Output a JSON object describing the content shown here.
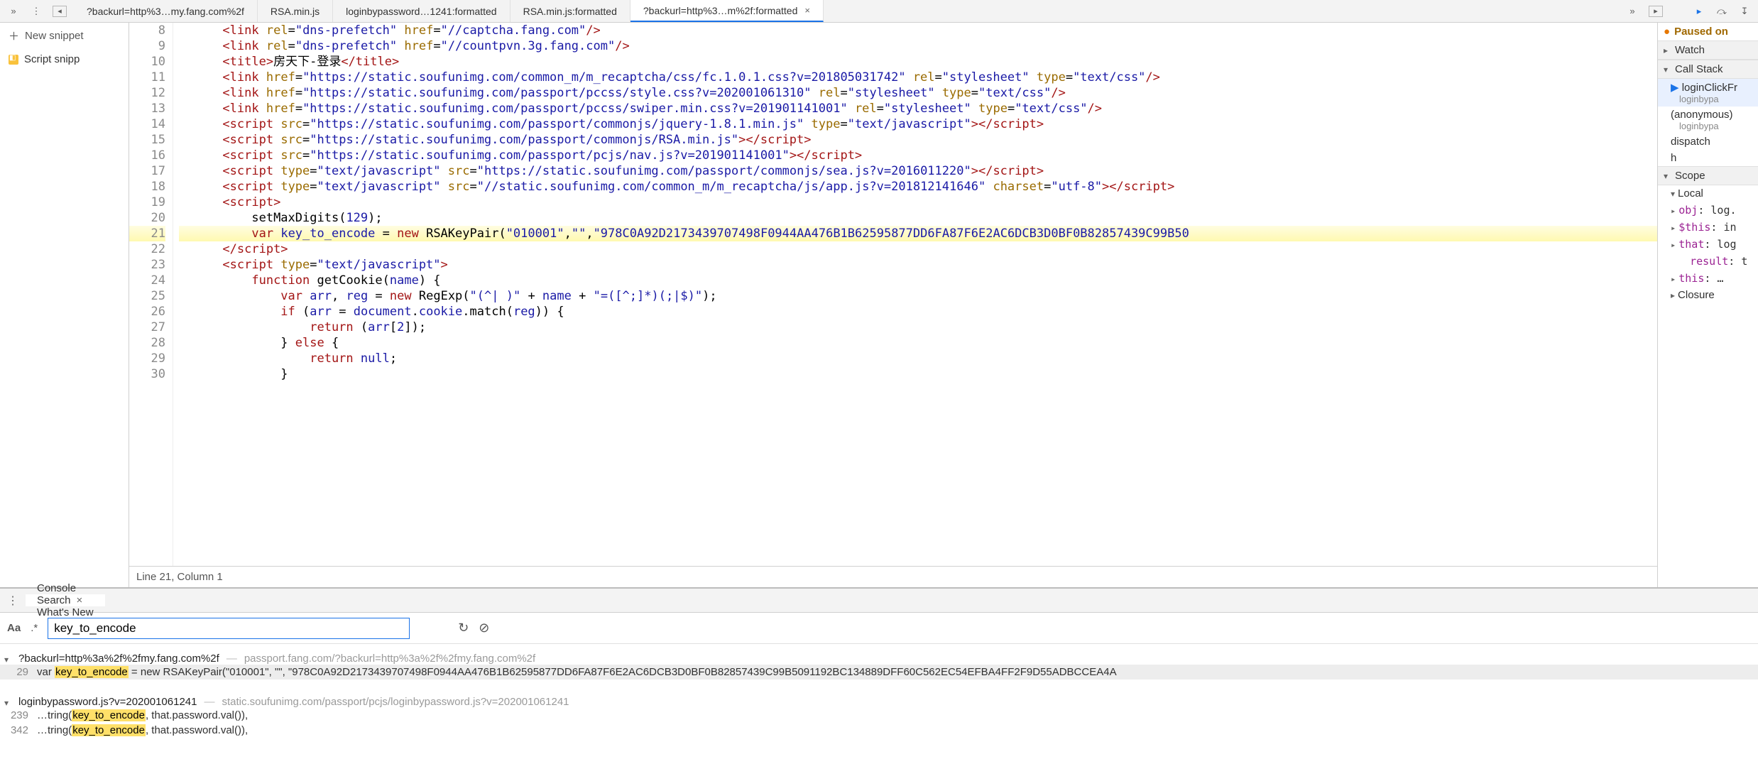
{
  "toolbar": {
    "tabs": [
      "?backurl=http%3…my.fang.com%2f",
      "RSA.min.js",
      "loginbypassword…1241:formatted",
      "RSA.min.js:formatted",
      "?backurl=http%3…m%2f:formatted"
    ],
    "active_tab_index": 4
  },
  "sidebar": {
    "add_label": "New snippet",
    "item_label": "Script snipp"
  },
  "code": {
    "first_line_no": 8,
    "status": "Line 21, Column 1",
    "lines_tokens": [
      [
        [
          "t-tag",
          "<link"
        ],
        [
          "t-js",
          " "
        ],
        [
          "t-attr",
          "rel"
        ],
        [
          "t-js",
          "="
        ],
        [
          "t-str",
          "\"dns-prefetch\""
        ],
        [
          "t-js",
          " "
        ],
        [
          "t-attr",
          "href"
        ],
        [
          "t-js",
          "="
        ],
        [
          "t-str",
          "\"//captcha.fang.com\""
        ],
        [
          "t-tag",
          "/>"
        ]
      ],
      [
        [
          "t-tag",
          "<link"
        ],
        [
          "t-js",
          " "
        ],
        [
          "t-attr",
          "rel"
        ],
        [
          "t-js",
          "="
        ],
        [
          "t-str",
          "\"dns-prefetch\""
        ],
        [
          "t-js",
          " "
        ],
        [
          "t-attr",
          "href"
        ],
        [
          "t-js",
          "="
        ],
        [
          "t-str",
          "\"//countpvn.3g.fang.com\""
        ],
        [
          "t-tag",
          "/>"
        ]
      ],
      [
        [
          "t-tag",
          "<title>"
        ],
        [
          "t-text",
          "房天下-登录"
        ],
        [
          "t-tag",
          "</title>"
        ]
      ],
      [
        [
          "t-tag",
          "<link"
        ],
        [
          "t-js",
          " "
        ],
        [
          "t-attr",
          "href"
        ],
        [
          "t-js",
          "="
        ],
        [
          "t-str",
          "\"https://static.soufunimg.com/common_m/m_recaptcha/css/fc.1.0.1.css?v=201805031742\""
        ],
        [
          "t-js",
          " "
        ],
        [
          "t-attr",
          "rel"
        ],
        [
          "t-js",
          "="
        ],
        [
          "t-str",
          "\"stylesheet\""
        ],
        [
          "t-js",
          " "
        ],
        [
          "t-attr",
          "type"
        ],
        [
          "t-js",
          "="
        ],
        [
          "t-str",
          "\"text/css\""
        ],
        [
          "t-tag",
          "/>"
        ]
      ],
      [
        [
          "t-tag",
          "<link"
        ],
        [
          "t-js",
          " "
        ],
        [
          "t-attr",
          "href"
        ],
        [
          "t-js",
          "="
        ],
        [
          "t-str",
          "\"https://static.soufunimg.com/passport/pccss/style.css?v=202001061310\""
        ],
        [
          "t-js",
          " "
        ],
        [
          "t-attr",
          "rel"
        ],
        [
          "t-js",
          "="
        ],
        [
          "t-str",
          "\"stylesheet\""
        ],
        [
          "t-js",
          " "
        ],
        [
          "t-attr",
          "type"
        ],
        [
          "t-js",
          "="
        ],
        [
          "t-str",
          "\"text/css\""
        ],
        [
          "t-tag",
          "/>"
        ]
      ],
      [
        [
          "t-tag",
          "<link"
        ],
        [
          "t-js",
          " "
        ],
        [
          "t-attr",
          "href"
        ],
        [
          "t-js",
          "="
        ],
        [
          "t-str",
          "\"https://static.soufunimg.com/passport/pccss/swiper.min.css?v=201901141001\""
        ],
        [
          "t-js",
          " "
        ],
        [
          "t-attr",
          "rel"
        ],
        [
          "t-js",
          "="
        ],
        [
          "t-str",
          "\"stylesheet\""
        ],
        [
          "t-js",
          " "
        ],
        [
          "t-attr",
          "type"
        ],
        [
          "t-js",
          "="
        ],
        [
          "t-str",
          "\"text/css\""
        ],
        [
          "t-tag",
          "/>"
        ]
      ],
      [
        [
          "t-tag",
          "<script"
        ],
        [
          "t-js",
          " "
        ],
        [
          "t-attr",
          "src"
        ],
        [
          "t-js",
          "="
        ],
        [
          "t-str",
          "\"https://static.soufunimg.com/passport/commonjs/jquery-1.8.1.min.js\""
        ],
        [
          "t-js",
          " "
        ],
        [
          "t-attr",
          "type"
        ],
        [
          "t-js",
          "="
        ],
        [
          "t-str",
          "\"text/javascript\""
        ],
        [
          "t-tag",
          "></script>"
        ]
      ],
      [
        [
          "t-tag",
          "<script"
        ],
        [
          "t-js",
          " "
        ],
        [
          "t-attr",
          "src"
        ],
        [
          "t-js",
          "="
        ],
        [
          "t-str",
          "\"https://static.soufunimg.com/passport/commonjs/RSA.min.js\""
        ],
        [
          "t-tag",
          "></script>"
        ]
      ],
      [
        [
          "t-tag",
          "<script"
        ],
        [
          "t-js",
          " "
        ],
        [
          "t-attr",
          "src"
        ],
        [
          "t-js",
          "="
        ],
        [
          "t-str",
          "\"https://static.soufunimg.com/passport/pcjs/nav.js?v=201901141001\""
        ],
        [
          "t-tag",
          "></script>"
        ]
      ],
      [
        [
          "t-tag",
          "<script"
        ],
        [
          "t-js",
          " "
        ],
        [
          "t-attr",
          "type"
        ],
        [
          "t-js",
          "="
        ],
        [
          "t-str",
          "\"text/javascript\""
        ],
        [
          "t-js",
          " "
        ],
        [
          "t-attr",
          "src"
        ],
        [
          "t-js",
          "="
        ],
        [
          "t-str",
          "\"https://static.soufunimg.com/passport/commonjs/sea.js?v=2016011220\""
        ],
        [
          "t-tag",
          "></script>"
        ]
      ],
      [
        [
          "t-tag",
          "<script"
        ],
        [
          "t-js",
          " "
        ],
        [
          "t-attr",
          "type"
        ],
        [
          "t-js",
          "="
        ],
        [
          "t-str",
          "\"text/javascript\""
        ],
        [
          "t-js",
          " "
        ],
        [
          "t-attr",
          "src"
        ],
        [
          "t-js",
          "="
        ],
        [
          "t-str",
          "\"//static.soufunimg.com/common_m/m_recaptcha/js/app.js?v=201812141646\""
        ],
        [
          "t-js",
          " "
        ],
        [
          "t-attr",
          "charset"
        ],
        [
          "t-js",
          "="
        ],
        [
          "t-str",
          "\"utf-8\""
        ],
        [
          "t-tag",
          "></script>"
        ]
      ],
      [
        [
          "t-tag",
          "<script>"
        ]
      ],
      [
        [
          "t-fn",
          "setMaxDigits"
        ],
        [
          "t-js",
          "("
        ],
        [
          "t-var",
          "129"
        ],
        [
          "t-js",
          ");"
        ]
      ],
      [
        [
          "t-kw",
          "var"
        ],
        [
          "t-js",
          " "
        ],
        [
          "t-var",
          "key_to_encode"
        ],
        [
          "t-js",
          " = "
        ],
        [
          "t-kw",
          "new"
        ],
        [
          "t-js",
          " "
        ],
        [
          "t-fn",
          "RSAKeyPair"
        ],
        [
          "t-js",
          "("
        ],
        [
          "t-str",
          "\"010001\""
        ],
        [
          "t-js",
          ","
        ],
        [
          "t-str",
          "\"\""
        ],
        [
          "t-js",
          ","
        ],
        [
          "t-str",
          "\"978C0A92D2173439707498F0944AA476B1B62595877DD6FA87F6E2AC6DCB3D0BF0B82857439C99B50"
        ]
      ],
      [
        [
          "t-tag",
          "</script>"
        ]
      ],
      [
        [
          "t-tag",
          "<script"
        ],
        [
          "t-js",
          " "
        ],
        [
          "t-attr",
          "type"
        ],
        [
          "t-js",
          "="
        ],
        [
          "t-str",
          "\"text/javascript\""
        ],
        [
          "t-tag",
          ">"
        ]
      ],
      [
        [
          "t-kw",
          "function"
        ],
        [
          "t-js",
          " "
        ],
        [
          "t-fn",
          "getCookie"
        ],
        [
          "t-js",
          "("
        ],
        [
          "t-var",
          "name"
        ],
        [
          "t-js",
          ") {"
        ]
      ],
      [
        [
          "t-kw",
          "var"
        ],
        [
          "t-js",
          " "
        ],
        [
          "t-var",
          "arr"
        ],
        [
          "t-js",
          ", "
        ],
        [
          "t-var",
          "reg"
        ],
        [
          "t-js",
          " = "
        ],
        [
          "t-kw",
          "new"
        ],
        [
          "t-js",
          " "
        ],
        [
          "t-fn",
          "RegExp"
        ],
        [
          "t-js",
          "("
        ],
        [
          "t-str",
          "\"(^| )\""
        ],
        [
          "t-js",
          " + "
        ],
        [
          "t-var",
          "name"
        ],
        [
          "t-js",
          " + "
        ],
        [
          "t-str",
          "\"=([^;]*)(;|$)\""
        ],
        [
          "t-js",
          ");"
        ]
      ],
      [
        [
          "t-kw",
          "if"
        ],
        [
          "t-js",
          " ("
        ],
        [
          "t-var",
          "arr"
        ],
        [
          "t-js",
          " = "
        ],
        [
          "t-var",
          "document"
        ],
        [
          "t-js",
          "."
        ],
        [
          "t-var",
          "cookie"
        ],
        [
          "t-js",
          "."
        ],
        [
          "t-fn",
          "match"
        ],
        [
          "t-js",
          "("
        ],
        [
          "t-var",
          "reg"
        ],
        [
          "t-js",
          ")) {"
        ]
      ],
      [
        [
          "t-kw",
          "return"
        ],
        [
          "t-js",
          " ("
        ],
        [
          "t-var",
          "arr"
        ],
        [
          "t-js",
          "["
        ],
        [
          "t-var",
          "2"
        ],
        [
          "t-js",
          "]);"
        ]
      ],
      [
        [
          "t-js",
          "} "
        ],
        [
          "t-kw",
          "else"
        ],
        [
          "t-js",
          " {"
        ]
      ],
      [
        [
          "t-kw",
          "return"
        ],
        [
          "t-js",
          " "
        ],
        [
          "t-var",
          "null"
        ],
        [
          "t-js",
          ";"
        ]
      ],
      [
        [
          "t-js",
          "}"
        ]
      ]
    ],
    "indent": [
      6,
      6,
      6,
      6,
      6,
      6,
      6,
      6,
      6,
      6,
      6,
      6,
      10,
      10,
      6,
      6,
      10,
      14,
      14,
      18,
      14,
      18,
      14
    ],
    "highlight_line_no": 21
  },
  "debugger": {
    "paused_label": "Paused on",
    "sections": {
      "watch": "Watch",
      "call_stack": "Call Stack",
      "scope": "Scope",
      "local": "Local",
      "closure": "Closure"
    },
    "call_stack": [
      {
        "name": "loginClickFr",
        "loc": "loginbypa",
        "selected": true
      },
      {
        "name": "(anonymous)",
        "loc": "loginbypa"
      },
      {
        "name": "dispatch",
        "loc": ""
      },
      {
        "name": "h",
        "loc": ""
      }
    ],
    "local": [
      {
        "k": "obj",
        "v": "log."
      },
      {
        "k": "$this",
        "v": "in"
      },
      {
        "k": "that",
        "v": "log"
      },
      {
        "k": "result",
        "v": "t",
        "no_tri": true
      },
      {
        "k": "this",
        "v": "…"
      }
    ]
  },
  "bottom": {
    "tabs": [
      "Console",
      "Search",
      "What's New"
    ],
    "active_tab_index": 1,
    "search_value": "key_to_encode",
    "results": [
      {
        "file": "?backurl=http%3a%2f%2fmy.fang.com%2f",
        "path": "passport.fang.com/?backurl=http%3a%2f%2fmy.fang.com%2f",
        "hits": [
          {
            "ln": 29,
            "pre": "var ",
            "mark": "key_to_encode",
            "post": " = new RSAKeyPair(\"010001\", \"\", \"978C0A92D2173439707498F0944AA476B1B62595877DD6FA87F6E2AC6DCB3D0BF0B82857439C99B5091192BC134889DFF60C562EC54EFBA4FF2F9D55ADBCCEA4A",
            "active": true
          }
        ]
      },
      {
        "file": "loginbypassword.js?v=202001061241",
        "path": "static.soufunimg.com/passport/pcjs/loginbypassword.js?v=202001061241",
        "hits": [
          {
            "ln": 239,
            "pre": "…tring(",
            "mark": "key_to_encode",
            "post": ", that.password.val()),"
          },
          {
            "ln": 342,
            "pre": "…tring(",
            "mark": "key_to_encode",
            "post": ", that.password.val()),"
          }
        ]
      }
    ]
  }
}
